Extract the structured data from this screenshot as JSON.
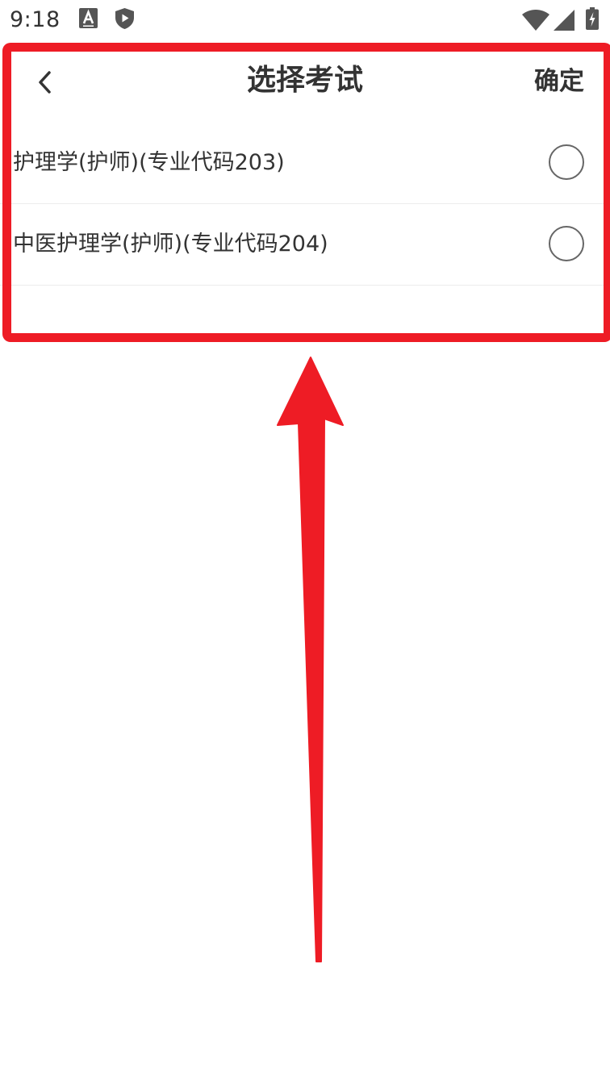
{
  "status_bar": {
    "time": "9:18",
    "icons": [
      "font-a-icon",
      "shield-play-icon",
      "wifi-icon",
      "cell-signal-icon",
      "battery-charging-icon"
    ]
  },
  "app_bar": {
    "back_icon": "chevron-left-icon",
    "title": "选择考试",
    "confirm_label": "确定"
  },
  "exams": [
    {
      "label": "护理学(护师)(专业代码203)",
      "selected": false
    },
    {
      "label": "中医护理学(护师)(专业代码204)",
      "selected": false
    }
  ],
  "colors": {
    "annotation": "#ee1c25",
    "text": "#333333",
    "radio_border": "#666666",
    "divider": "#ececec"
  }
}
